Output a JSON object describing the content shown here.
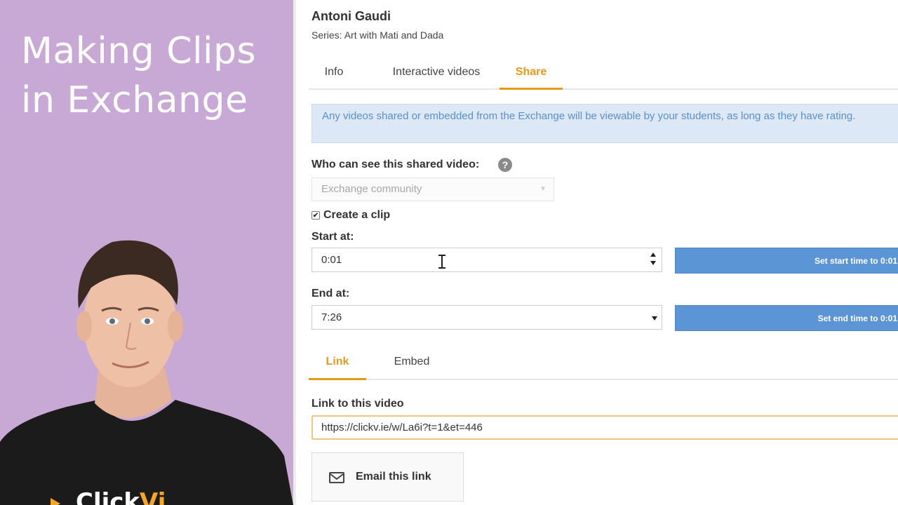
{
  "promo": {
    "title_line1": "Making Clips",
    "title_line2": "in Exchange",
    "brand_word": "Click",
    "brand_accent": "Vi"
  },
  "video": {
    "title": "Antoni Gaudi",
    "series": "Series: Art with Mati and Dada"
  },
  "tabs": [
    {
      "label": "Info",
      "active": false
    },
    {
      "label": "Interactive videos",
      "active": false
    },
    {
      "label": "Share",
      "active": true
    }
  ],
  "alert": {
    "text": "Any videos shared or embedded from the Exchange will be viewable by your students, as long as they have rating."
  },
  "visibility": {
    "label": "Who can see this shared video:",
    "help_icon": "question-circle-icon",
    "selected": "Exchange community"
  },
  "clip": {
    "checkbox_label": "Create a clip",
    "checked": true,
    "start_label": "Start at:",
    "start_value": "0:01",
    "end_label": "End at:",
    "end_value": "7:26",
    "set_start_button": "Set start time to 0:01",
    "set_end_button": "Set end time to 0:01"
  },
  "share_tabs": [
    {
      "label": "Link",
      "active": true
    },
    {
      "label": "Embed",
      "active": false
    }
  ],
  "link": {
    "label": "Link to this video",
    "url": "https://clickv.ie/w/La6i?t=1&et=446",
    "email_button": "Email this link",
    "email_icon": "envelope-icon"
  },
  "colors": {
    "accent": "#e79a14",
    "button_blue": "#5b95d6",
    "panel_purple": "#c8a9d5",
    "alert_bg": "#dce8f5"
  }
}
